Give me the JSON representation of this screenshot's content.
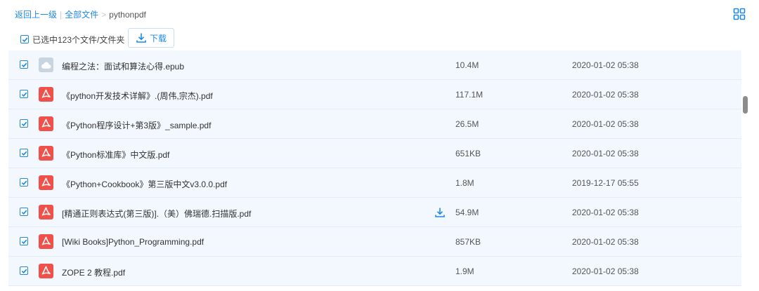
{
  "breadcrumb": {
    "back": "返回上一级",
    "sep1": "|",
    "all_files": "全部文件",
    "sep2": ">",
    "current": "pythonpdf"
  },
  "toolbar": {
    "selected_text": "已选中123个文件/文件夹",
    "download_label": "下载",
    "view_mode_icon": "grid-view-icon"
  },
  "colors": {
    "accent": "#1e88e5",
    "pdf": "#f0504a",
    "row_bg": "#f2f8fe"
  },
  "files": [
    {
      "name": "编程之法：面试和算法心得.epub",
      "size": "10.4M",
      "date": "2020-01-02 05:38",
      "icon": "epub-file-icon",
      "hover": false
    },
    {
      "name": "《python开发技术详解》.(周伟,宗杰).pdf",
      "size": "117.1M",
      "date": "2020-01-02 05:38",
      "icon": "pdf-file-icon",
      "hover": false
    },
    {
      "name": "《Python程序设计+第3版》_sample.pdf",
      "size": "26.5M",
      "date": "2020-01-02 05:38",
      "icon": "pdf-file-icon",
      "hover": false
    },
    {
      "name": "《Python标准库》中文版.pdf",
      "size": "651KB",
      "date": "2020-01-02 05:38",
      "icon": "pdf-file-icon",
      "hover": false
    },
    {
      "name": "《Python+Cookbook》第三版中文v3.0.0.pdf",
      "size": "1.8M",
      "date": "2019-12-17 05:55",
      "icon": "pdf-file-icon",
      "hover": false
    },
    {
      "name": "[精通正则表达式(第三版)].（美）佛瑞德.扫描版.pdf",
      "size": "54.9M",
      "date": "2020-01-02 05:38",
      "icon": "pdf-file-icon",
      "hover": true
    },
    {
      "name": "[Wiki Books]Python_Programming.pdf",
      "size": "857KB",
      "date": "2020-01-02 05:38",
      "icon": "pdf-file-icon",
      "hover": false
    },
    {
      "name": "ZOPE 2 教程.pdf",
      "size": "1.9M",
      "date": "2020-01-02 05:38",
      "icon": "pdf-file-icon",
      "hover": false
    }
  ]
}
